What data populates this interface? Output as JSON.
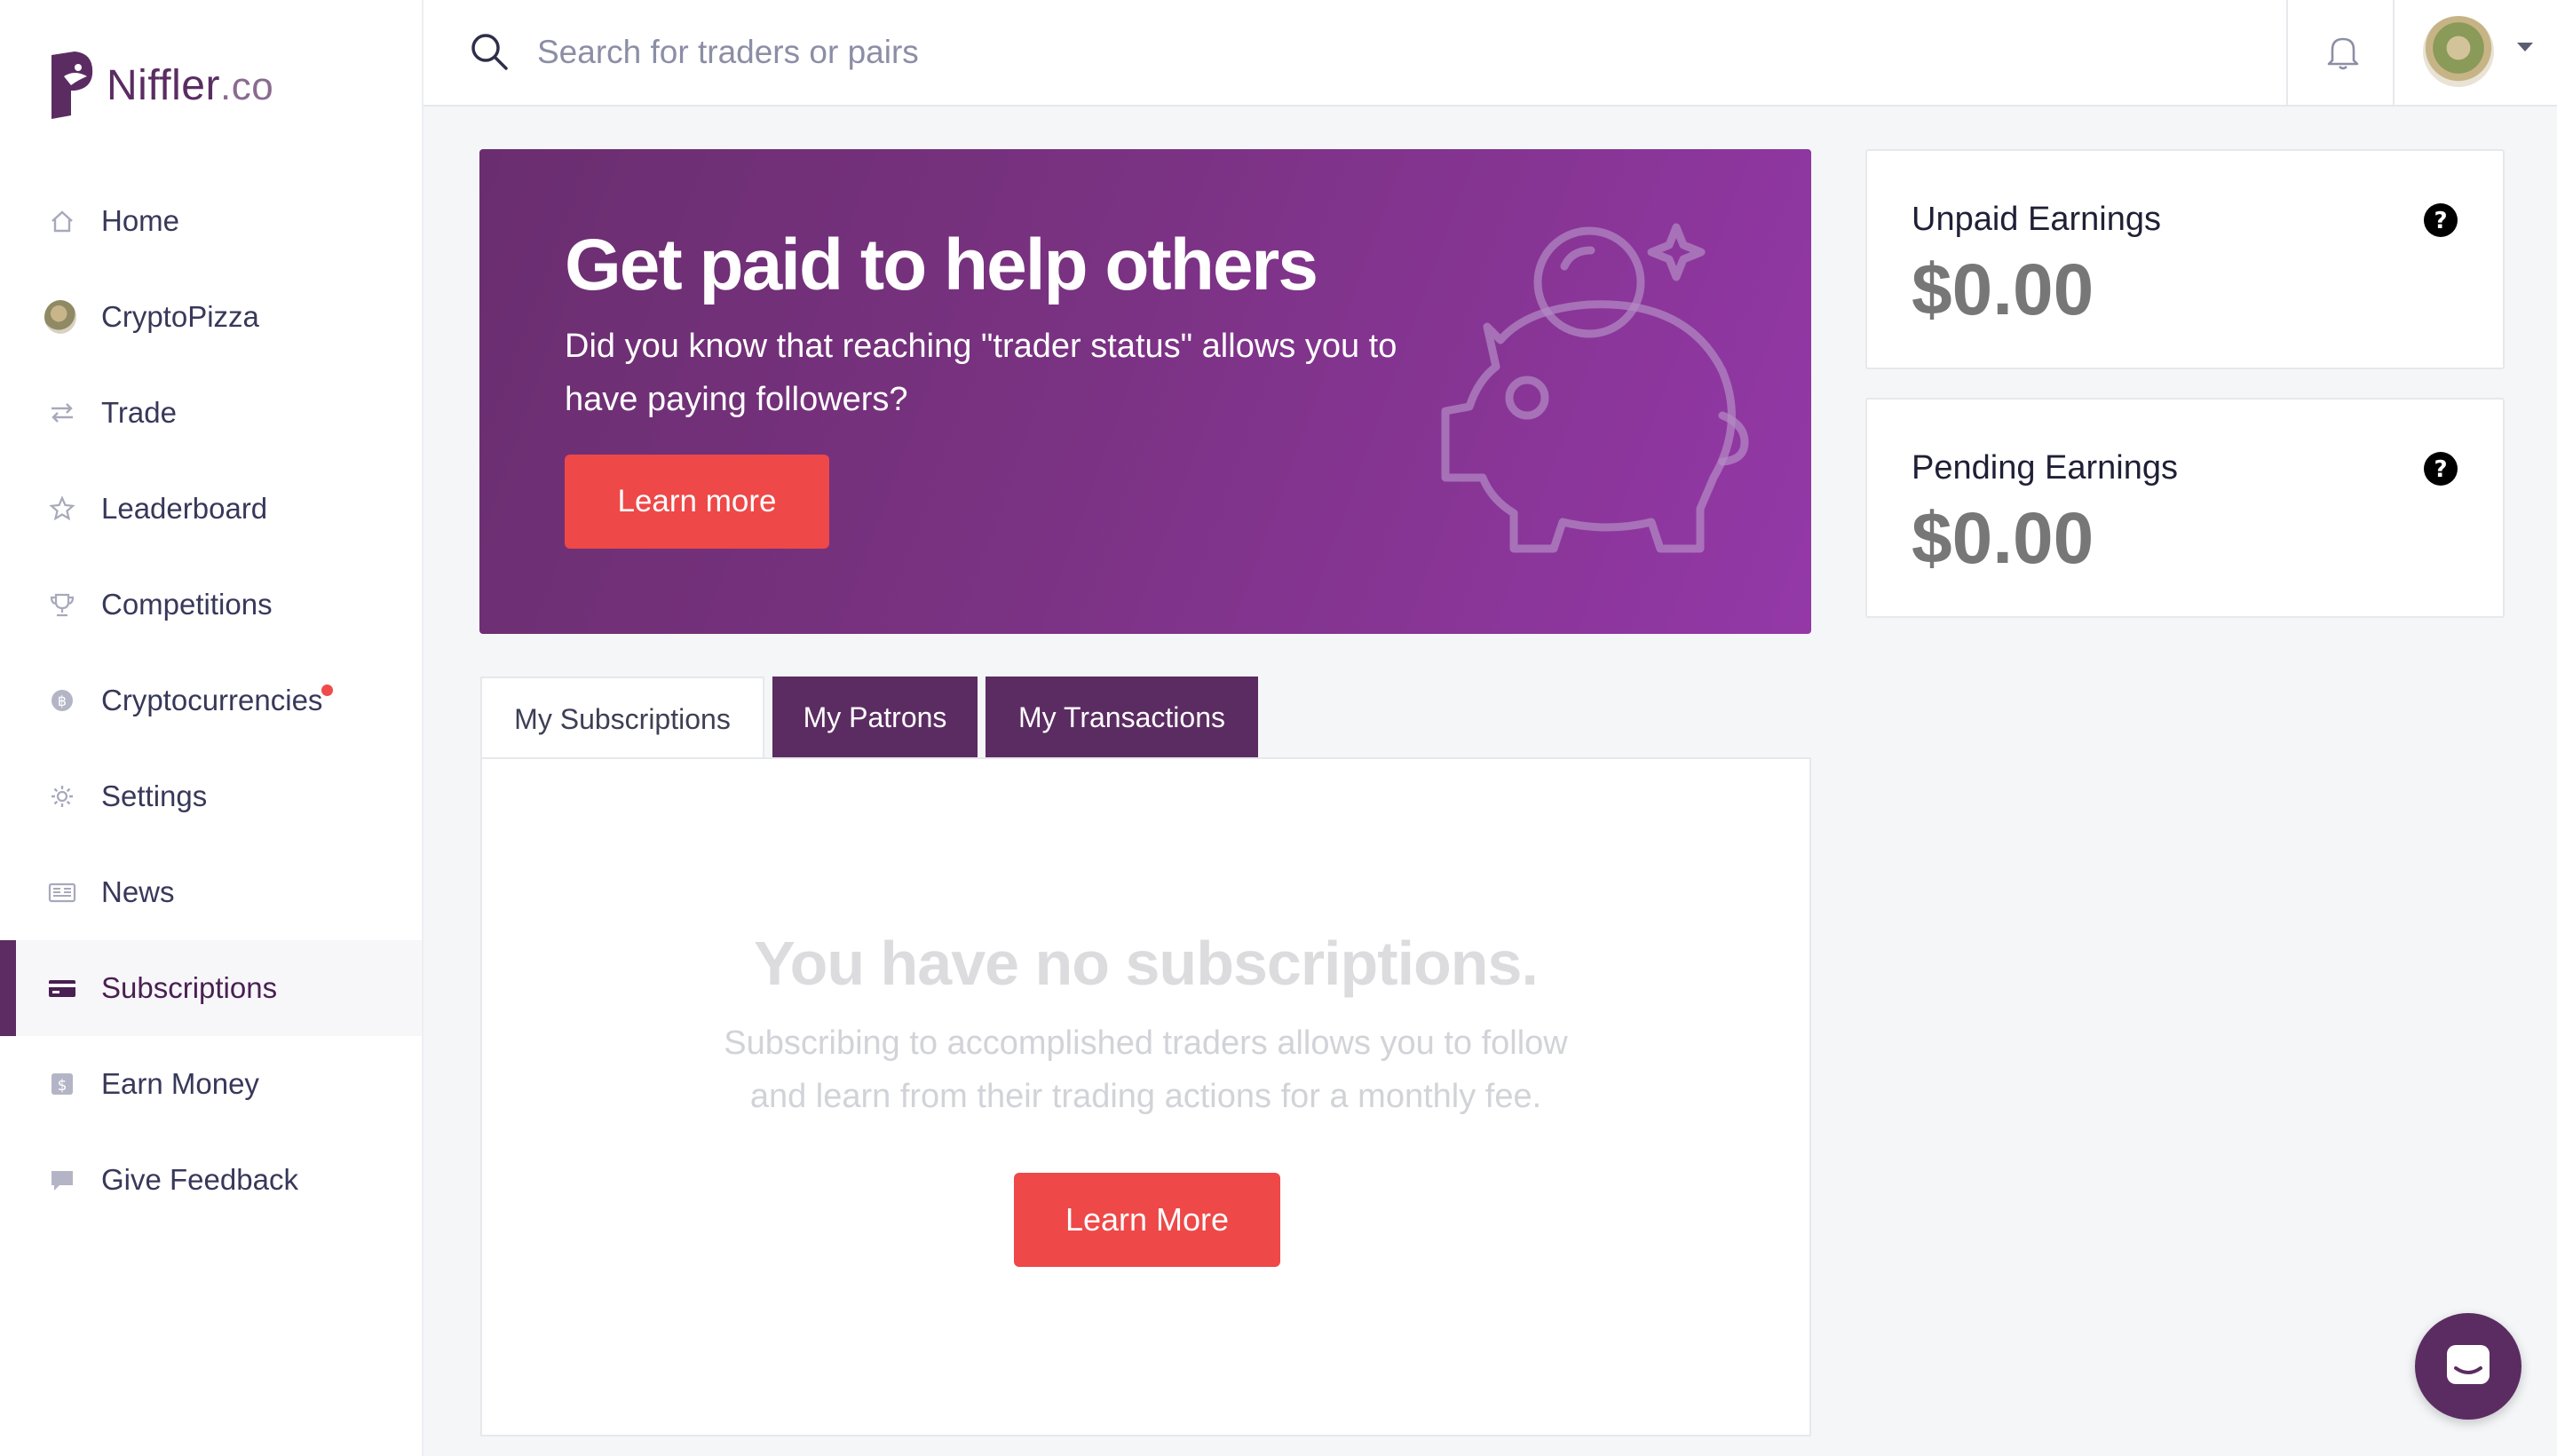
{
  "brand": {
    "name": "Niffler",
    "tld": ".co"
  },
  "search": {
    "placeholder": "Search for traders or pairs"
  },
  "sidebar": {
    "items": [
      {
        "label": "Home",
        "icon": "home-icon"
      },
      {
        "label": "CryptoPizza",
        "icon": "avatar"
      },
      {
        "label": "Trade",
        "icon": "arrows-icon"
      },
      {
        "label": "Leaderboard",
        "icon": "star-icon"
      },
      {
        "label": "Competitions",
        "icon": "trophy-icon"
      },
      {
        "label": "Cryptocurrencies",
        "icon": "coin-icon",
        "badge": "dot"
      },
      {
        "label": "Settings",
        "icon": "gear-icon"
      },
      {
        "label": "News",
        "icon": "newspaper-icon"
      },
      {
        "label": "Subscriptions",
        "icon": "credit-card-icon",
        "active": true
      },
      {
        "label": "Earn Money",
        "icon": "dollar-icon"
      },
      {
        "label": "Give Feedback",
        "icon": "chat-bubble-icon"
      }
    ]
  },
  "hero": {
    "title": "Get paid to help others",
    "text": "Did you know that reaching \"trader status\" allows you to have paying followers?",
    "button": "Learn more",
    "icon": "piggy-bank-icon"
  },
  "earnings": {
    "unpaid": {
      "title": "Unpaid Earnings",
      "value": "$0.00"
    },
    "pending": {
      "title": "Pending Earnings",
      "value": "$0.00"
    }
  },
  "tabs": [
    {
      "label": "My Subscriptions",
      "active": true
    },
    {
      "label": "My Patrons"
    },
    {
      "label": "My Transactions"
    }
  ],
  "empty": {
    "title": "You have no subscriptions.",
    "text": "Subscribing to accomplished traders allows you to follow and learn from their trading actions for a monthly fee.",
    "button": "Learn More"
  },
  "colors": {
    "brand": "#5b2c62",
    "accent": "#ee4848",
    "hero_start": "#6a2e6f",
    "hero_end": "#9438a8"
  }
}
